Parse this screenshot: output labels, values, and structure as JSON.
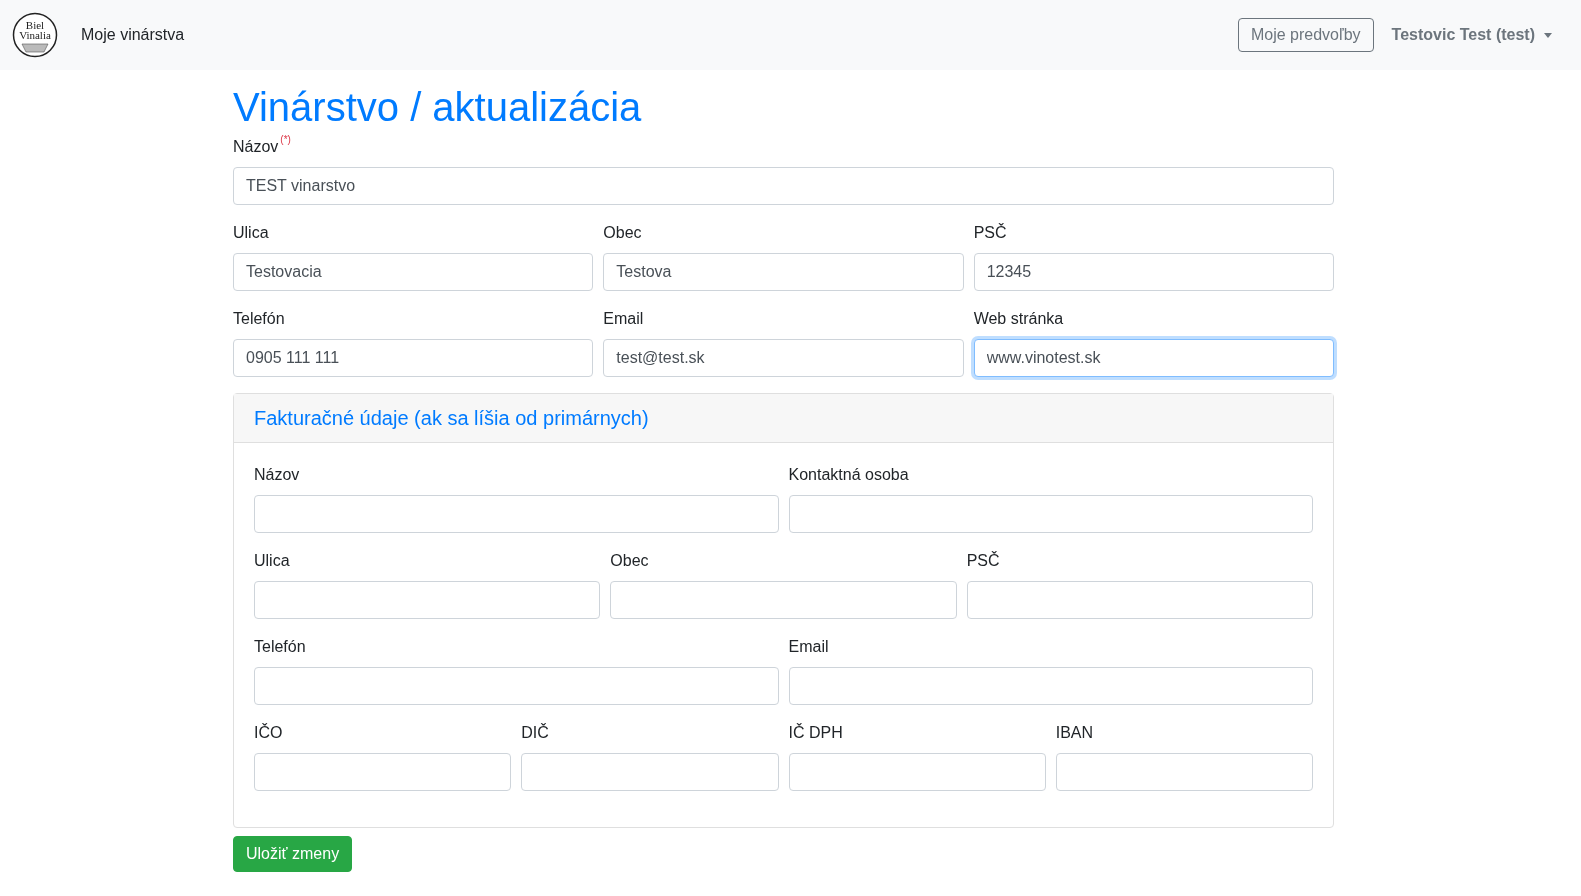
{
  "navbar": {
    "logo": {
      "lines": [
        "Biel",
        "Vinalia"
      ]
    },
    "brand": "Moje vinárstva",
    "prefs_button": "Moje predvoľby",
    "user_menu": "Testovic Test (test)"
  },
  "title": "Vinárstvo / aktualizácia",
  "main_rows": [
    {
      "fields": [
        {
          "label": "Názov",
          "required_mark": "(*)",
          "value": "TEST vinarstvo",
          "focused": false
        }
      ]
    },
    {
      "fields": [
        {
          "label": "Ulica",
          "value": "Testovacia",
          "focused": false
        },
        {
          "label": "Obec",
          "value": "Testova",
          "focused": false
        },
        {
          "label": "PSČ",
          "value": "12345",
          "focused": false
        }
      ]
    },
    {
      "fields": [
        {
          "label": "Telefón",
          "value": "0905 111 111",
          "focused": false
        },
        {
          "label": "Email",
          "value": "test@test.sk",
          "focused": false
        },
        {
          "label": "Web stránka",
          "value": "www.vinotest.sk",
          "focused": true
        }
      ]
    }
  ],
  "billing": {
    "title": "Fakturačné údaje (ak sa líšia od primárnych)",
    "rows": [
      {
        "fields": [
          {
            "label": "Názov",
            "focused": false
          },
          {
            "label": "Kontaktná osoba",
            "focused": false
          }
        ]
      },
      {
        "fields": [
          {
            "label": "Ulica",
            "focused": false
          },
          {
            "label": "Obec",
            "focused": false
          },
          {
            "label": "PSČ",
            "focused": false
          }
        ]
      },
      {
        "fields": [
          {
            "label": "Telefón",
            "focused": false
          },
          {
            "label": "Email",
            "focused": false
          }
        ]
      },
      {
        "fields": [
          {
            "label": "IČO",
            "focused": false
          },
          {
            "label": "DIČ",
            "focused": false
          },
          {
            "label": "IČ DPH",
            "focused": false
          },
          {
            "label": "IBAN",
            "focused": false
          }
        ]
      }
    ]
  },
  "submit_button": "Uložiť zmeny"
}
